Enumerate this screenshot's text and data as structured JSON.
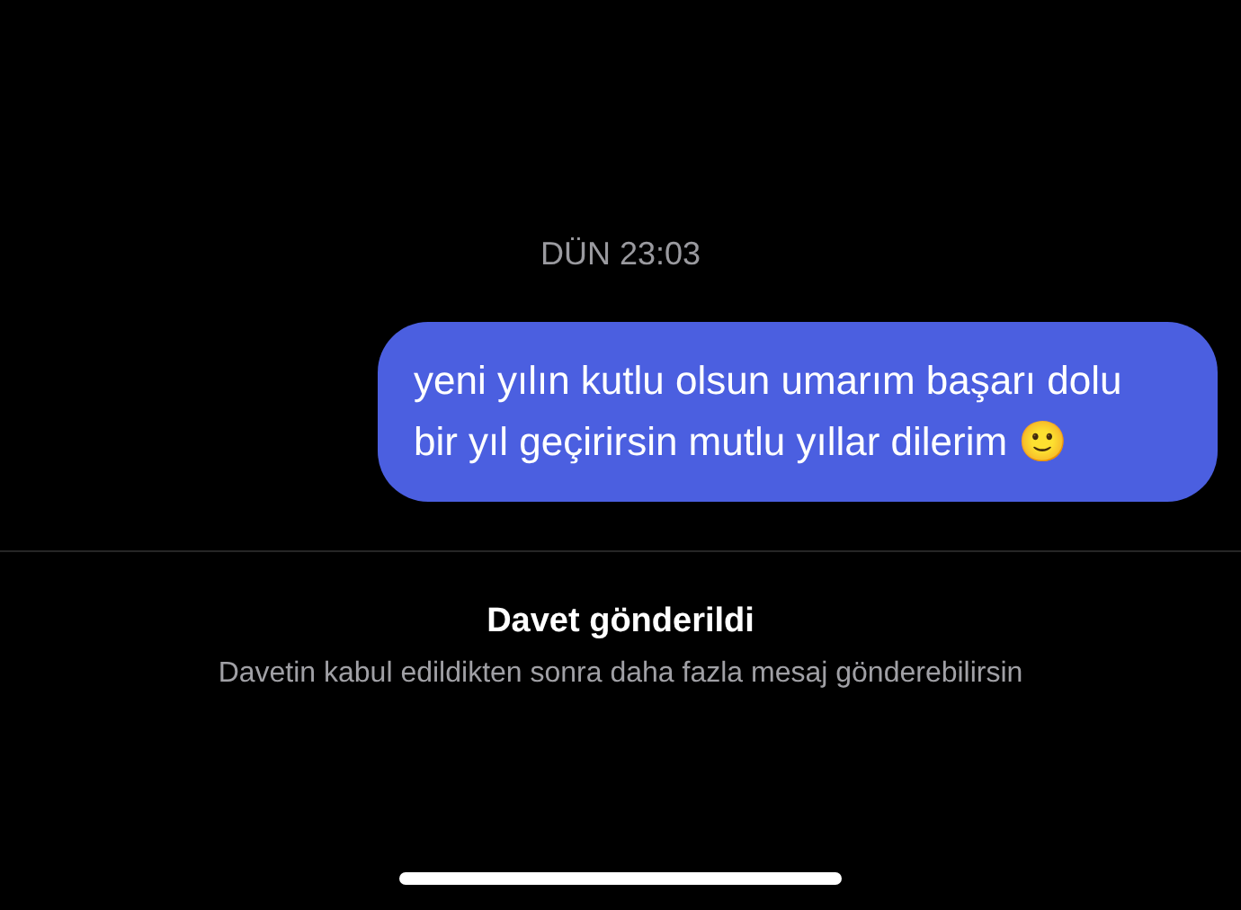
{
  "timestamp": "DÜN 23:03",
  "messages": [
    {
      "text": "yeni yılın kutlu olsun umarım başarı dolu bir yıl geçirirsin mutlu yıllar dilerim 🙂",
      "outgoing": true
    }
  ],
  "notice": {
    "title": "Davet gönderildi",
    "subtitle": "Davetin kabul edildikten sonra daha fazla mesaj gönderebilirsin"
  }
}
